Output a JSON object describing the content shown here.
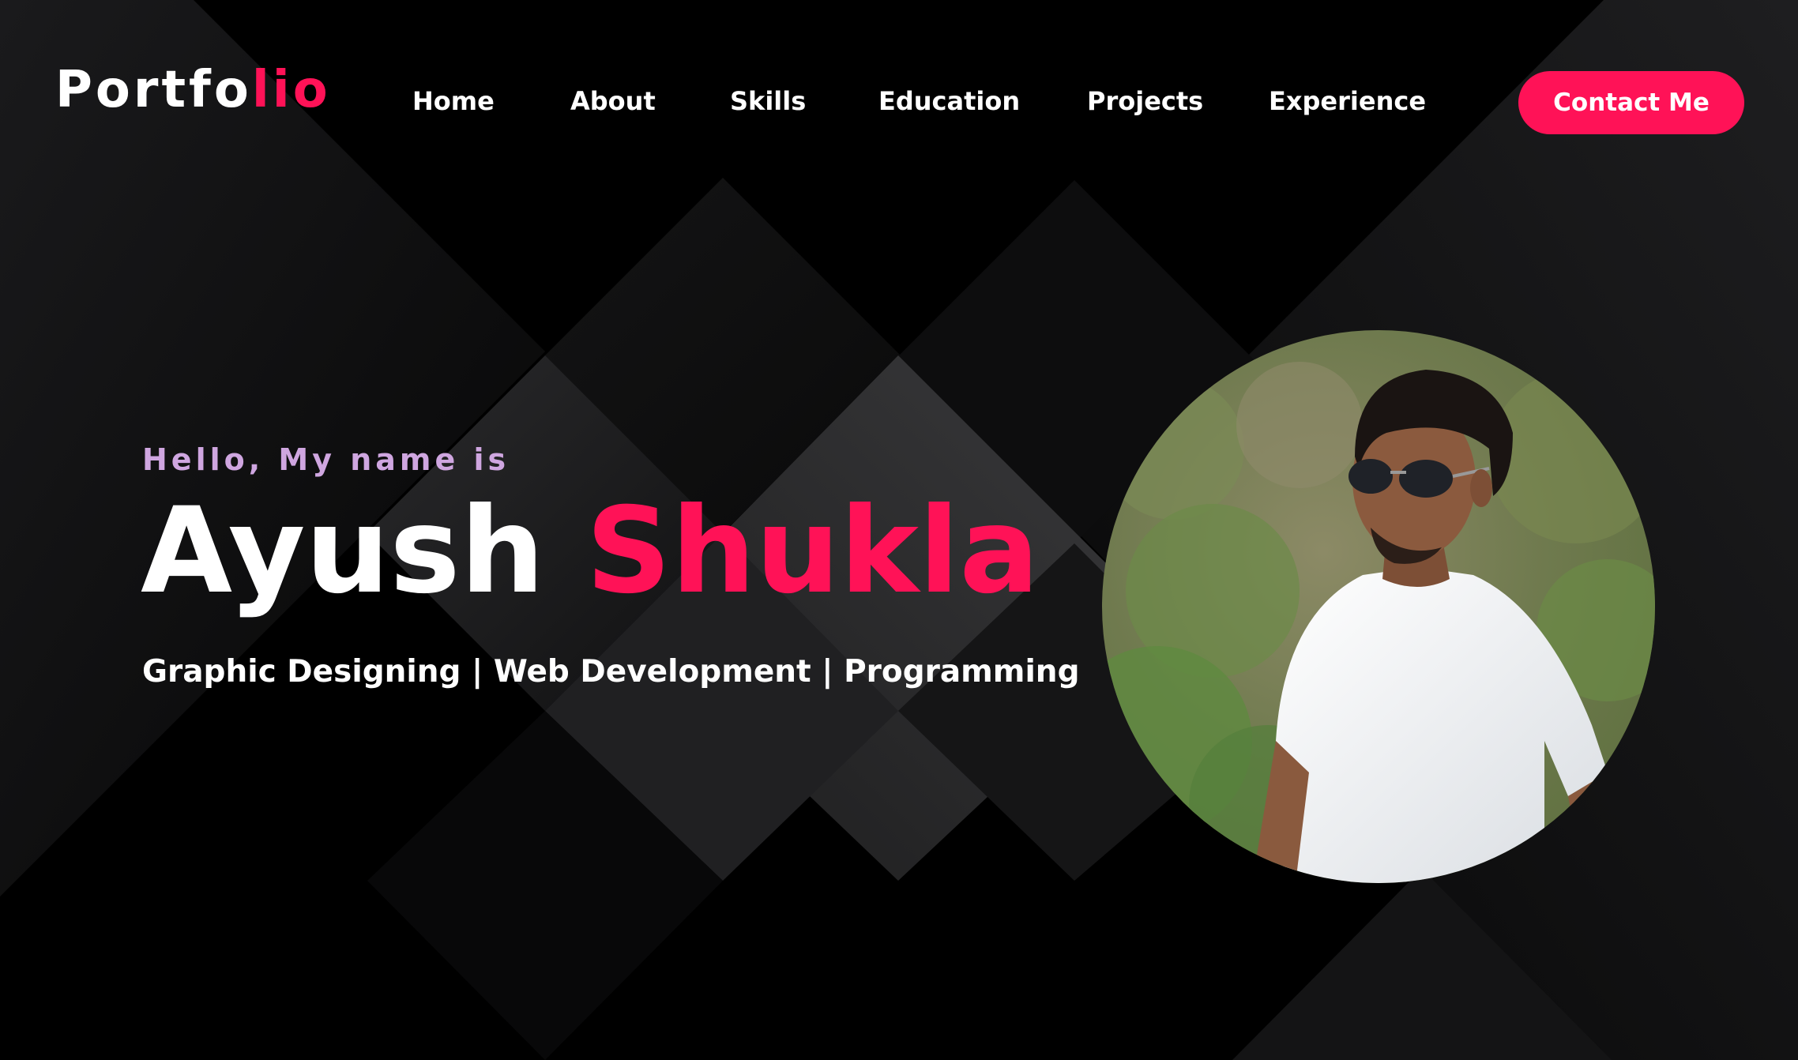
{
  "header": {
    "logo": {
      "part1": "Portfo",
      "part2": "lio"
    },
    "nav": [
      {
        "label": "Home"
      },
      {
        "label": "About"
      },
      {
        "label": "Skills"
      },
      {
        "label": "Education"
      },
      {
        "label": "Projects"
      },
      {
        "label": "Experience"
      }
    ],
    "contact_label": "Contact Me"
  },
  "hero": {
    "greeting": "Hello, My name is",
    "first_name": "Ayush",
    "last_name": "Shukla",
    "tagline": "Graphic Designing | Web Development | Programming"
  },
  "colors": {
    "accent": "#ff1257",
    "greeting": "#cfa6e0",
    "background": "#000000",
    "text": "#ffffff"
  }
}
